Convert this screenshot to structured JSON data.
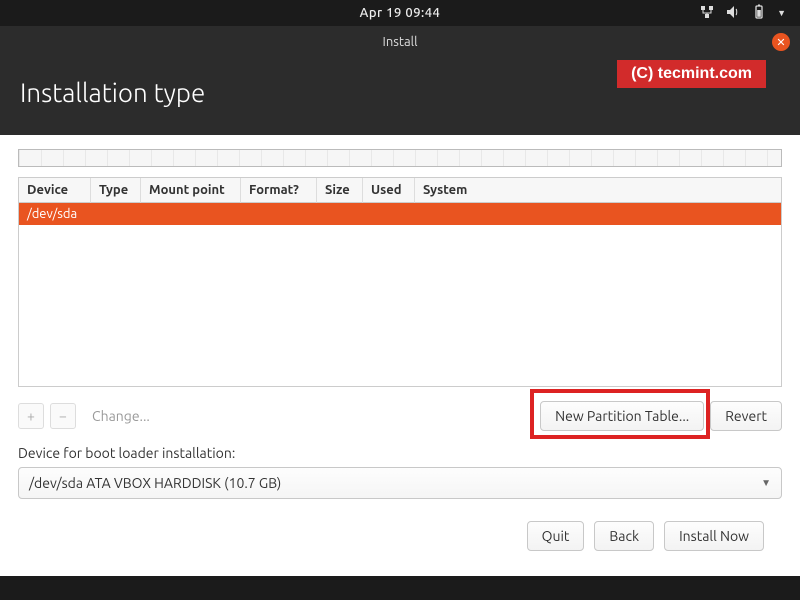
{
  "topbar": {
    "clock": "Apr 19  09:44"
  },
  "titlebar": {
    "title": "Install"
  },
  "watermark": "(C) tecmint.com",
  "header": {
    "title": "Installation type"
  },
  "columns": {
    "device": "Device",
    "type": "Type",
    "mount": "Mount point",
    "format": "Format?",
    "size": "Size",
    "used": "Used",
    "system": "System"
  },
  "rows": [
    {
      "device": "/dev/sda",
      "type": "",
      "mount": "",
      "format": "",
      "size": "",
      "used": "",
      "system": ""
    }
  ],
  "toolbar": {
    "add": "+",
    "remove": "−",
    "change": "Change...",
    "new_table": "New Partition Table...",
    "revert": "Revert"
  },
  "boot": {
    "label": "Device for boot loader installation:",
    "value": "/dev/sda ATA VBOX HARDDISK (10.7 GB)"
  },
  "footer": {
    "quit": "Quit",
    "back": "Back",
    "install": "Install Now"
  }
}
